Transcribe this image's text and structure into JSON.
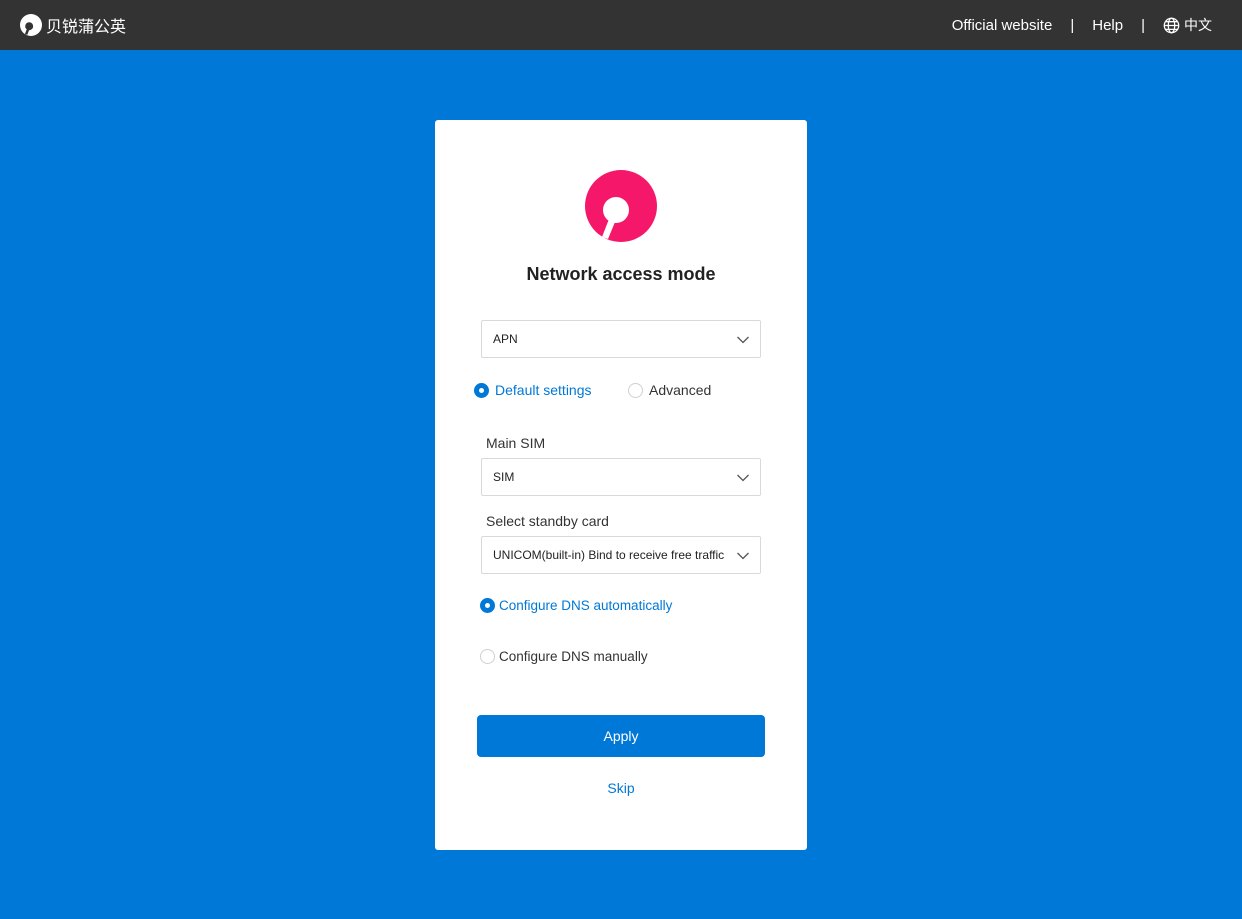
{
  "header": {
    "brand_name": "贝锐蒲公英",
    "nav": {
      "official_website": "Official website",
      "separator": "|",
      "help": "Help",
      "language": "中文"
    }
  },
  "card": {
    "title": "Network access mode",
    "mode_select": {
      "value": "APN"
    },
    "settings_radio": {
      "default_label": "Default settings",
      "advanced_label": "Advanced",
      "selected": "default"
    },
    "main_sim": {
      "label": "Main SIM",
      "value": "SIM"
    },
    "standby_card": {
      "label": "Select standby card",
      "value": "UNICOM(built-in) Bind to receive free traffic"
    },
    "dns": {
      "auto_label": "Configure DNS automatically",
      "manual_label": "Configure DNS manually",
      "selected": "auto"
    },
    "apply_label": "Apply",
    "skip_label": "Skip"
  },
  "colors": {
    "background": "#0078d7",
    "topbar": "#333333",
    "accent": "#0078d7",
    "logo": "#f5186a"
  }
}
